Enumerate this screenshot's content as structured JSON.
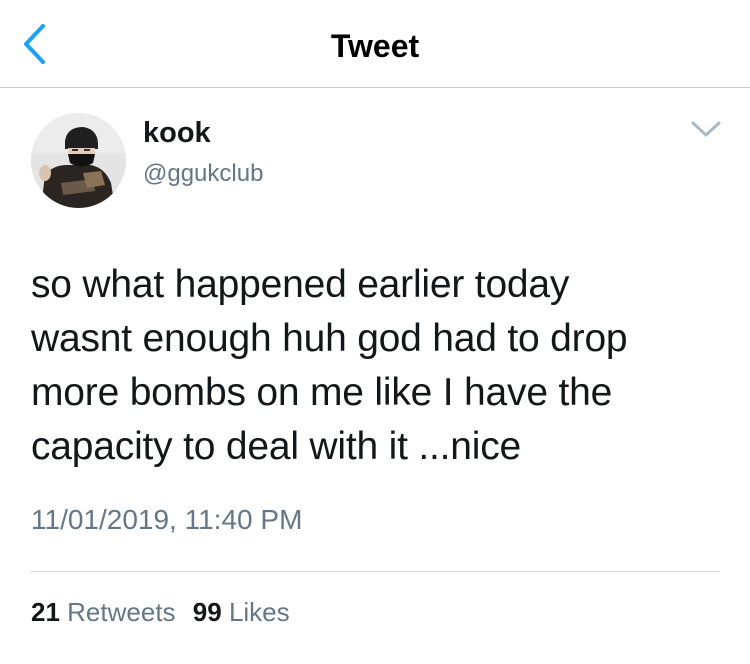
{
  "nav": {
    "title": "Tweet",
    "back_icon": "chevron-left-icon",
    "accent_color": "#1da1f2"
  },
  "tweet": {
    "author": {
      "display_name": "kook",
      "handle": "@ggukclub"
    },
    "text": "so what happened earlier today\nwasnt enough huh god had to drop\nmore bombs on me like I have the\ncapacity to deal with it ...nice",
    "timestamp": "11/01/2019, 11:40 PM",
    "stats": {
      "retweets_count": "21",
      "retweets_label": "Retweets",
      "likes_count": "99",
      "likes_label": "Likes"
    }
  }
}
